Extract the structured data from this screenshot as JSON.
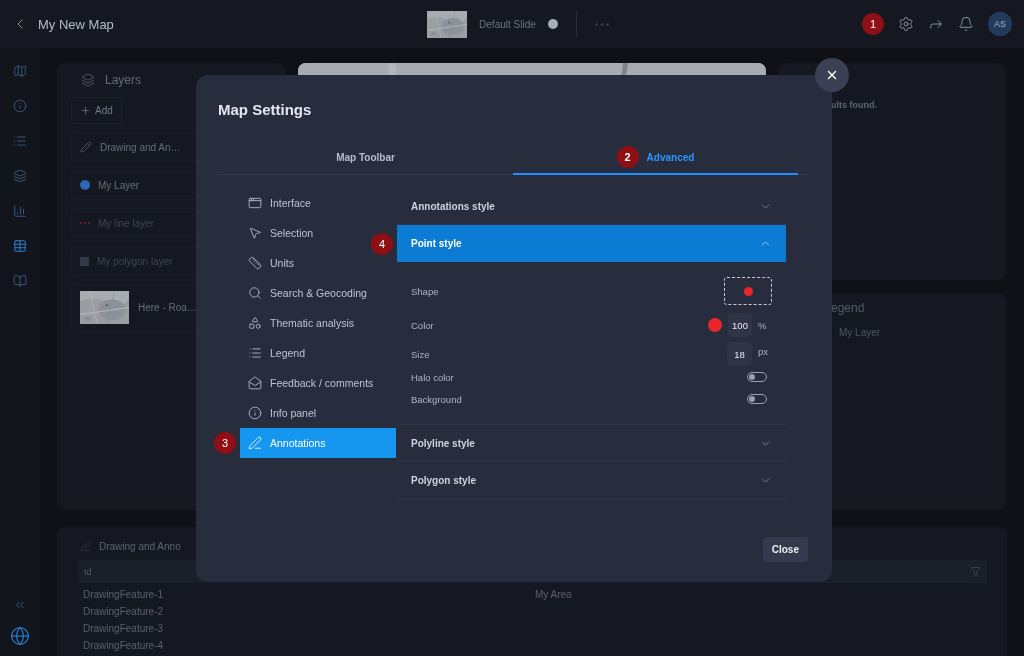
{
  "top_bar": {
    "title": "My New Map",
    "slide": {
      "name": "Default Slide"
    },
    "callout": "1",
    "avatar": "AS"
  },
  "rail": [
    {
      "kind": "map",
      "selected": false
    },
    {
      "kind": "info",
      "selected": false
    },
    {
      "kind": "list",
      "selected": false
    },
    {
      "kind": "layers",
      "selected": false
    },
    {
      "kind": "chart",
      "selected": false
    },
    {
      "kind": "table",
      "selected": true
    },
    {
      "kind": "book",
      "selected": false
    }
  ],
  "layers_panel": {
    "title": "Layers",
    "add_button": "Add",
    "items": [
      {
        "kind": "drawing",
        "name": "Drawing and An…",
        "visible": true
      },
      {
        "kind": "point",
        "name": "My Layer",
        "visible": true
      },
      {
        "kind": "line",
        "name": "My line layer",
        "visible": false
      },
      {
        "kind": "polygon",
        "name": "My polygon layer",
        "visible": false
      },
      {
        "kind": "basemap",
        "name": "Here - Roa…",
        "visible": true
      }
    ]
  },
  "results_panel": {
    "message": "ults found."
  },
  "legend_panel": {
    "title": "egend",
    "items": [
      "My Layer"
    ]
  },
  "table_panel": {
    "tab": "Drawing and Anno",
    "columns": [
      "Id"
    ],
    "rows": [
      [
        "DrawingFeature-1",
        "My Area"
      ],
      [
        "DrawingFeature-2"
      ],
      [
        "DrawingFeature-3"
      ],
      [
        "DrawingFeature-4"
      ]
    ]
  },
  "dialog": {
    "title": "Map Settings",
    "tabs": [
      {
        "label": "Map Toolbar",
        "selected": false
      },
      {
        "label": "Advanced",
        "selected": true,
        "callout": "2"
      }
    ],
    "menu": [
      {
        "kind": "interface",
        "label": "Interface",
        "selected": false
      },
      {
        "kind": "selection",
        "label": "Selection",
        "selected": false
      },
      {
        "kind": "units",
        "label": "Units",
        "selected": false
      },
      {
        "kind": "search",
        "label": "Search & Geocoding",
        "selected": false
      },
      {
        "kind": "thematic",
        "label": "Thematic analysis",
        "selected": false
      },
      {
        "kind": "legend",
        "label": "Legend",
        "selected": false
      },
      {
        "kind": "feedback",
        "label": "Feedback / comments",
        "selected": false
      },
      {
        "kind": "info",
        "label": "Info panel",
        "selected": false
      },
      {
        "kind": "annotations",
        "label": "Annotations",
        "selected": true,
        "callout": "3"
      }
    ],
    "sections": [
      {
        "title": "Annotations style",
        "expanded": false
      },
      {
        "title": "Point style",
        "expanded": true,
        "callout": "4",
        "fields": [
          {
            "kind": "shape",
            "label": "Shape"
          },
          {
            "kind": "color",
            "label": "Color",
            "value": "100",
            "unit": "%"
          },
          {
            "kind": "number",
            "label": "Size",
            "value": "18",
            "unit": "px"
          },
          {
            "kind": "toggle",
            "label": "Halo color",
            "on": false
          },
          {
            "kind": "toggle",
            "label": "Background",
            "on": false
          }
        ]
      },
      {
        "title": "Polyline style",
        "expanded": false
      },
      {
        "title": "Polygon style",
        "expanded": false
      }
    ],
    "close_button": "Close"
  }
}
